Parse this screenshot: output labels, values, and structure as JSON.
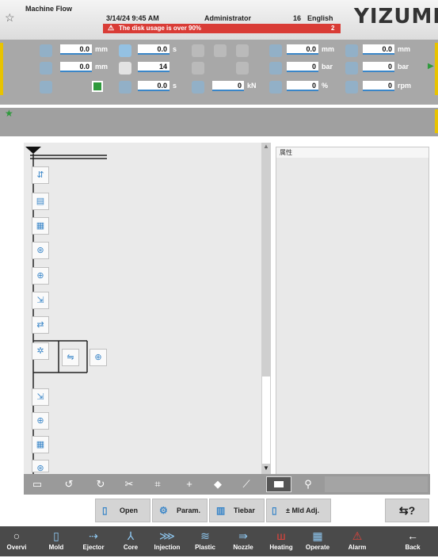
{
  "header": {
    "app_title": "Machine Flow",
    "datetime": "3/14/24 9:45 AM",
    "user": "Administrator",
    "number": "16",
    "language": "English",
    "alarm_text": "The disk usage is over 90%",
    "alarm_count": "2",
    "logo": "YIZUMI"
  },
  "status": {
    "row1": [
      {
        "value": "0.0",
        "unit": "mm"
      },
      {
        "value": "0.0",
        "unit": "s"
      },
      {
        "value": "0.0",
        "unit": "mm"
      },
      {
        "value": "0.0",
        "unit": "mm"
      }
    ],
    "row2": [
      {
        "value": "0.0",
        "unit": "mm"
      },
      {
        "value": "14",
        "unit": ""
      },
      {
        "value": "0",
        "unit": "bar"
      },
      {
        "value": "0",
        "unit": "bar"
      }
    ],
    "row3": [
      {
        "value": "0.0",
        "unit": "s"
      },
      {
        "value": "0",
        "unit": "kN"
      },
      {
        "value": "0",
        "unit": "%"
      },
      {
        "value": "0",
        "unit": "rpm"
      }
    ]
  },
  "properties": {
    "title": "属性"
  },
  "toolbar_icons": [
    "save-icon",
    "undo-icon",
    "redo-icon",
    "tool-icon",
    "crop-icon",
    "add-icon",
    "erase-icon",
    "link-icon",
    "view-icon",
    "zoom-icon"
  ],
  "function_buttons": {
    "open": "Open",
    "param": "Param.",
    "tiebar": "Tiebar",
    "mld_adj": "± Mld Adj."
  },
  "nav": {
    "overview": "Overvi",
    "mold": "Mold",
    "ejector": "Ejector",
    "core": "Core",
    "injection": "Injection",
    "plastic": "Plastic",
    "nozzle": "Nozzle",
    "heating": "Heating",
    "operate": "Operate",
    "alarm": "Alarm",
    "back": "Back"
  },
  "colors": {
    "accent": "#3a86c8",
    "alarm": "#d93c36",
    "panel": "#a8a8a8",
    "nav": "#4a4a4a",
    "highlight": "#e8c300",
    "indicator": "#2e9a3c"
  }
}
